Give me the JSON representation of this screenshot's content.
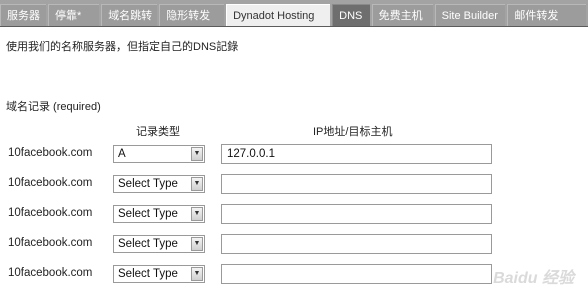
{
  "tabs": [
    {
      "label": "服务器",
      "style": "normal"
    },
    {
      "label": "停靠*",
      "style": "normal"
    },
    {
      "label": "域名跳转",
      "style": "normal"
    },
    {
      "label": "隐形转发",
      "style": "normal"
    },
    {
      "label": "Dynadot Hosting",
      "style": "light"
    },
    {
      "label": "DNS",
      "style": "active"
    },
    {
      "label": "免费主机",
      "style": "normal"
    },
    {
      "label": "Site Builder",
      "style": "normal"
    },
    {
      "label": "邮件转发",
      "style": "normal"
    }
  ],
  "subtitle": "使用我们的名称服务器，但指定自己的DNS記錄",
  "section_label": "域名记录 (required)",
  "columns": {
    "record_type": "记录类型",
    "ip_target": "IP地址/目标主机"
  },
  "rows": [
    {
      "domain": "10facebook.com",
      "record_type": "A",
      "ip": "127.0.0.1"
    },
    {
      "domain": "10facebook.com",
      "record_type": "Select Type",
      "ip": ""
    },
    {
      "domain": "10facebook.com",
      "record_type": "Select Type",
      "ip": ""
    },
    {
      "domain": "10facebook.com",
      "record_type": "Select Type",
      "ip": ""
    },
    {
      "domain": "10facebook.com",
      "record_type": "Select Type",
      "ip": ""
    }
  ],
  "watermark": "Baidu 经验",
  "colors": {
    "tab_bg": "#9c9c9c",
    "tab_active": "#6e6e6e",
    "tab_light": "#efefef",
    "bar": "#a3a3a3"
  }
}
